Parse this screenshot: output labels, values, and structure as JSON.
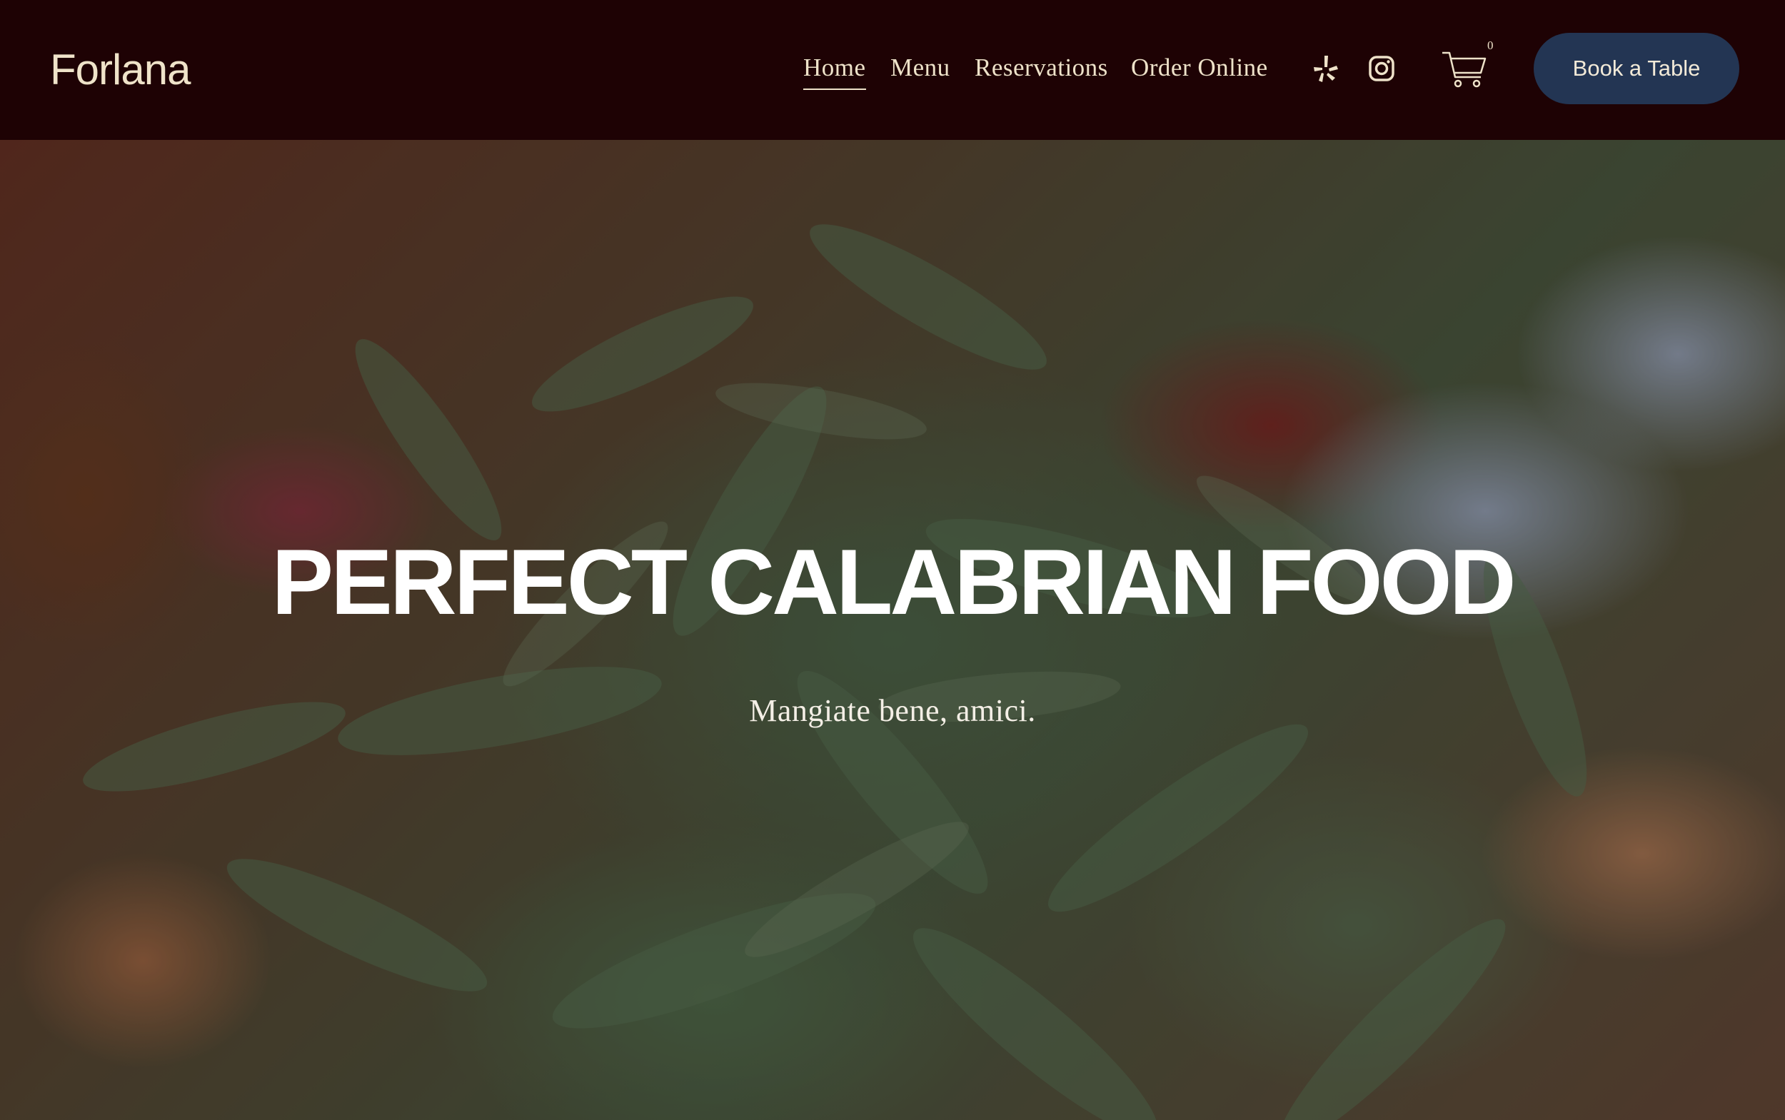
{
  "header": {
    "logo": "Forlana",
    "nav": [
      {
        "label": "Home",
        "active": true
      },
      {
        "label": "Menu",
        "active": false
      },
      {
        "label": "Reservations",
        "active": false
      },
      {
        "label": "Order Online",
        "active": false
      }
    ],
    "social_icons": [
      "yelp-icon",
      "instagram-icon"
    ],
    "cart": {
      "icon": "cart-icon",
      "count": "0"
    },
    "cta_label": "Book a Table"
  },
  "hero": {
    "background": "pizza-with-arugula-and-prosciutto-photo",
    "title": "PERFECT CALABRIAN FOOD",
    "subtitle": "Mangiate bene, amici."
  },
  "colors": {
    "header_bg": "#1e0204",
    "header_text": "#eee2c9",
    "cta_bg": "#233553",
    "cta_text": "#f2ead8",
    "hero_text": "#ffffff"
  }
}
